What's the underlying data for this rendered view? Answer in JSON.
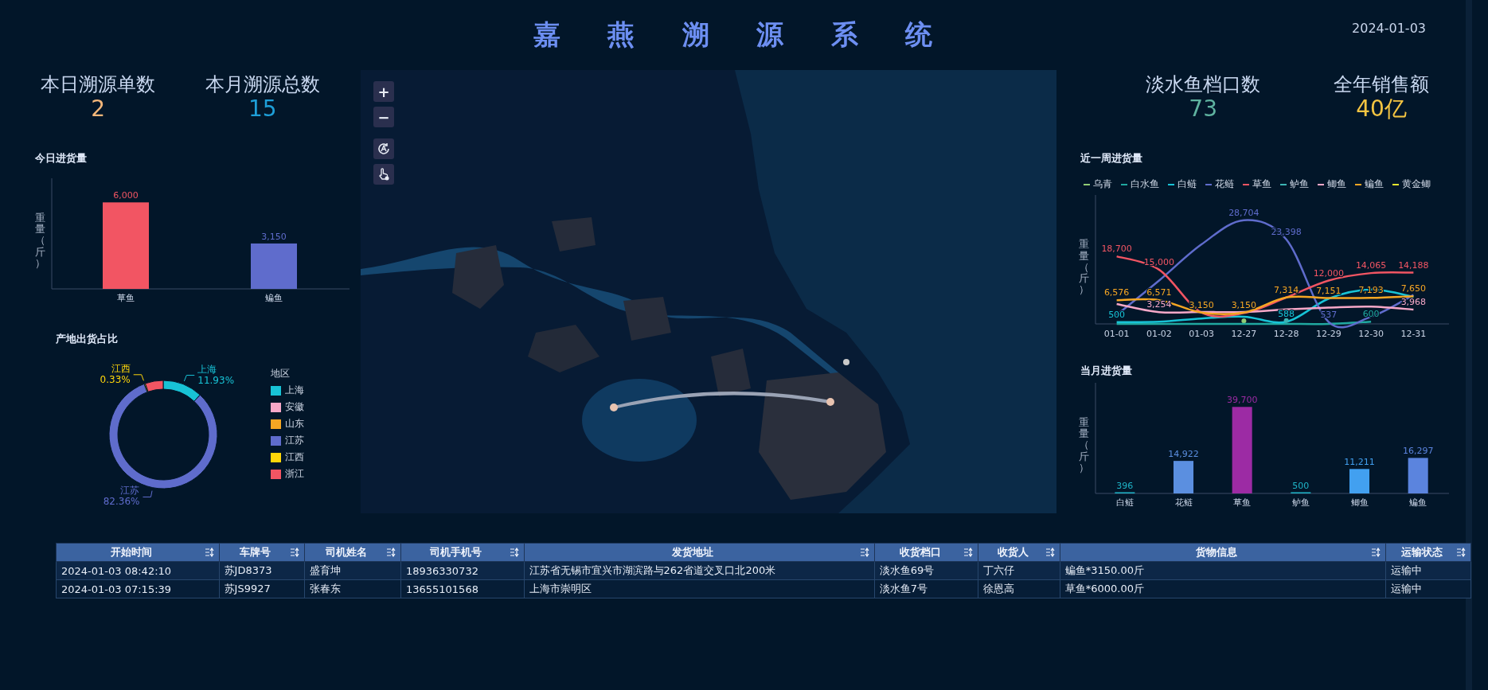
{
  "header": {
    "title": "嘉燕溯源系统",
    "date": "2024-01-03"
  },
  "left_stats": [
    {
      "label": "本日溯源单数",
      "value": "2",
      "color": "#f5b77a"
    },
    {
      "label": "本月溯源总数",
      "value": "15",
      "color": "#1e9fd8"
    }
  ],
  "today_chart": {
    "title": "今日进货量",
    "chart_data": {
      "type": "bar",
      "ylabel": "重量（斤）",
      "categories": [
        "草鱼",
        "鳊鱼"
      ],
      "values": [
        6000,
        3150
      ],
      "colors": [
        "#f25563",
        "#5f6ccc"
      ],
      "value_labels": [
        "6,000",
        "3,150"
      ]
    }
  },
  "origin_chart": {
    "title": "产地出货占比",
    "legend_title": "地区",
    "chart_data": {
      "type": "donut",
      "categories": [
        "上海",
        "安徽",
        "山东",
        "江苏",
        "江西",
        "浙江"
      ],
      "values": [
        11.93,
        0,
        0,
        82.36,
        0.33,
        5.38
      ],
      "colors": [
        "#18c3d6",
        "#f7a8c8",
        "#f5a623",
        "#5f6ccc",
        "#ffd60a",
        "#f25563"
      ],
      "value_labels": [
        "11.93%",
        null,
        null,
        "82.36%",
        "0.33%",
        null
      ]
    }
  },
  "map": {
    "kind": "picture",
    "controls": [
      {
        "kind": "zoom_in",
        "label": "+"
      },
      {
        "kind": "zoom_out",
        "label": "−"
      },
      {
        "kind": "rotate"
      },
      {
        "kind": "pointer"
      }
    ]
  },
  "right_stats": [
    {
      "label": "淡水鱼档口数",
      "value": "73",
      "color": "#5fb3a0"
    },
    {
      "label": "全年销售额",
      "value": "40亿",
      "color": "#f5c542"
    }
  ],
  "week_chart": {
    "title": "近一周进货量",
    "chart_data": {
      "type": "line",
      "ylabel": "重量（斤）",
      "categories": [
        "01-01",
        "01-02",
        "01-03",
        "12-27",
        "12-28",
        "12-29",
        "12-30",
        "12-31"
      ],
      "series": [
        {
          "name": "乌青",
          "color": "#91cc75",
          "marker": true,
          "values": [
            null,
            null,
            null,
            400,
            null,
            null,
            null,
            null
          ],
          "value_labels": [
            null,
            null,
            null,
            null,
            null,
            null,
            null,
            null
          ]
        },
        {
          "name": "白水鱼",
          "color": "#20a8a0",
          "values": [
            0,
            0,
            0,
            0,
            0,
            0,
            600,
            null
          ],
          "value_labels": [
            null,
            null,
            null,
            null,
            null,
            null,
            "600",
            null
          ]
        },
        {
          "name": "白鲢",
          "color": "#18c3d6",
          "values": [
            500,
            600,
            1500,
            2000,
            588,
            7000,
            9500,
            7500
          ],
          "value_labels": [
            "500",
            null,
            null,
            null,
            "588",
            null,
            null,
            null
          ]
        },
        {
          "name": "花鲢",
          "color": "#5f6ccc",
          "values": [
            2500,
            12000,
            22000,
            28704,
            23398,
            537,
            2000,
            8000
          ],
          "value_labels": [
            null,
            null,
            null,
            "28,704",
            "23,398",
            "537",
            null,
            null
          ]
        },
        {
          "name": "草鱼",
          "color": "#f25563",
          "values": [
            18700,
            15000,
            3150,
            3000,
            7314,
            12000,
            14065,
            14188
          ],
          "value_labels": [
            "18,700",
            "15,000",
            null,
            null,
            null,
            "12,000",
            "14,065",
            "14,188"
          ]
        },
        {
          "name": "鲈鱼",
          "color": "#3cb4b4",
          "marker": true,
          "values": [
            null,
            null,
            null,
            null,
            500,
            null,
            null,
            null
          ],
          "value_labels": [
            null,
            null,
            null,
            null,
            null,
            null,
            null,
            null
          ]
        },
        {
          "name": "鲫鱼",
          "color": "#f7a8c8",
          "values": [
            5500,
            3254,
            3300,
            3300,
            4000,
            4500,
            4800,
            3968
          ],
          "value_labels": [
            null,
            "3,254",
            null,
            null,
            null,
            null,
            null,
            "3,968"
          ]
        },
        {
          "name": "鳊鱼",
          "color": "#f5a623",
          "values": [
            6576,
            6571,
            3150,
            3150,
            7314,
            7151,
            7193,
            7650
          ],
          "value_labels": [
            "6,576",
            "6,571",
            "3,150",
            "3,150",
            "7,314",
            "7,151",
            "7,193",
            "7,650"
          ]
        },
        {
          "name": "黄金鲫",
          "color": "#e6e62e",
          "values": [
            null,
            null,
            null,
            null,
            null,
            null,
            null,
            null
          ],
          "value_labels": [
            null,
            null,
            null,
            null,
            null,
            null,
            null,
            null
          ]
        }
      ]
    }
  },
  "month_chart": {
    "title": "当月进货量",
    "chart_data": {
      "type": "bar",
      "ylabel": "重量（斤）",
      "categories": [
        "白鲢",
        "花鲢",
        "草鱼",
        "鲈鱼",
        "鲫鱼",
        "鳊鱼"
      ],
      "values": [
        396,
        14922,
        39700,
        500,
        11211,
        16297
      ],
      "colors": [
        "#1fb5c9",
        "#5b8fe0",
        "#9c2ba4",
        "#1fb5c9",
        "#42a0f0",
        "#5b84de"
      ],
      "value_labels": [
        "396",
        "14,922",
        "39,700",
        "500",
        "11,211",
        "16,297"
      ]
    }
  },
  "table": {
    "columns": [
      {
        "label": "开始时间"
      },
      {
        "label": "车牌号"
      },
      {
        "label": "司机姓名"
      },
      {
        "label": "司机手机号"
      },
      {
        "label": "发货地址"
      },
      {
        "label": "收货档口"
      },
      {
        "label": "收货人"
      },
      {
        "label": "货物信息"
      },
      {
        "label": "运输状态"
      }
    ],
    "rows": [
      {
        "cells": [
          "2024-01-03 08:42:10",
          "苏JD8373",
          "盛育坤",
          "18936330732",
          "江苏省无锡市宜兴市湖滨路与262省道交叉口北200米",
          "淡水鱼69号",
          "丁六仔",
          "鳊鱼*3150.00斤",
          "运输中"
        ]
      },
      {
        "cells": [
          "2024-01-03 07:15:39",
          "苏JS9927",
          "张春东",
          "13655101568",
          "上海市崇明区",
          "淡水鱼7号",
          "徐恩高",
          "草鱼*6000.00斤",
          "运输中"
        ]
      }
    ]
  }
}
